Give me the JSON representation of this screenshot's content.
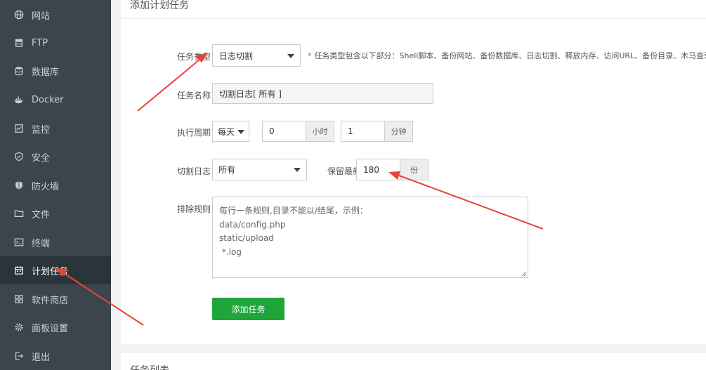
{
  "sidebar": {
    "items": [
      {
        "label": "网站",
        "icon": "globe-icon"
      },
      {
        "label": "FTP",
        "icon": "ftp-icon"
      },
      {
        "label": "数据库",
        "icon": "database-icon"
      },
      {
        "label": "Docker",
        "icon": "docker-icon"
      },
      {
        "label": "监控",
        "icon": "monitor-icon"
      },
      {
        "label": "安全",
        "icon": "shield-check-icon"
      },
      {
        "label": "防火墙",
        "icon": "firewall-icon"
      },
      {
        "label": "文件",
        "icon": "folder-icon"
      },
      {
        "label": "终端",
        "icon": "terminal-icon"
      },
      {
        "label": "计划任务",
        "icon": "calendar-icon",
        "active": true
      },
      {
        "label": "软件商店",
        "icon": "apps-icon"
      },
      {
        "label": "面板设置",
        "icon": "gear-icon"
      },
      {
        "label": "退出",
        "icon": "logout-icon"
      }
    ]
  },
  "form": {
    "title": "添加计划任务",
    "task_type": {
      "label": "任务类型",
      "value": "日志切割"
    },
    "hint": "任务类型包含以下部分：Shell脚本、备份网站、备份数据库、日志切割、释放内存、访问URL、备份目录、木马查杀、",
    "task_name": {
      "label": "任务名称",
      "value": "切割日志[ 所有 ]"
    },
    "period": {
      "label": "执行周期",
      "type": "每天",
      "hour": "0",
      "hour_unit": "小时",
      "minute": "1",
      "minute_unit": "分钟"
    },
    "cut_log": {
      "label": "切割日志",
      "value": "所有"
    },
    "keep": {
      "label": "保留最新",
      "value": "180",
      "unit": "份"
    },
    "exclude": {
      "label": "排除规则",
      "lines": [
        "每行一条规则,目录不能以/结尾，示例：",
        "data/config.php",
        "static/upload",
        " *.log"
      ]
    },
    "submit": "添加任务"
  },
  "task_list": {
    "title": "任务列表"
  },
  "colors": {
    "sidebar_bg": "#3c444d",
    "accent_green": "#20a53a",
    "arrow_red": "#e8443a"
  }
}
